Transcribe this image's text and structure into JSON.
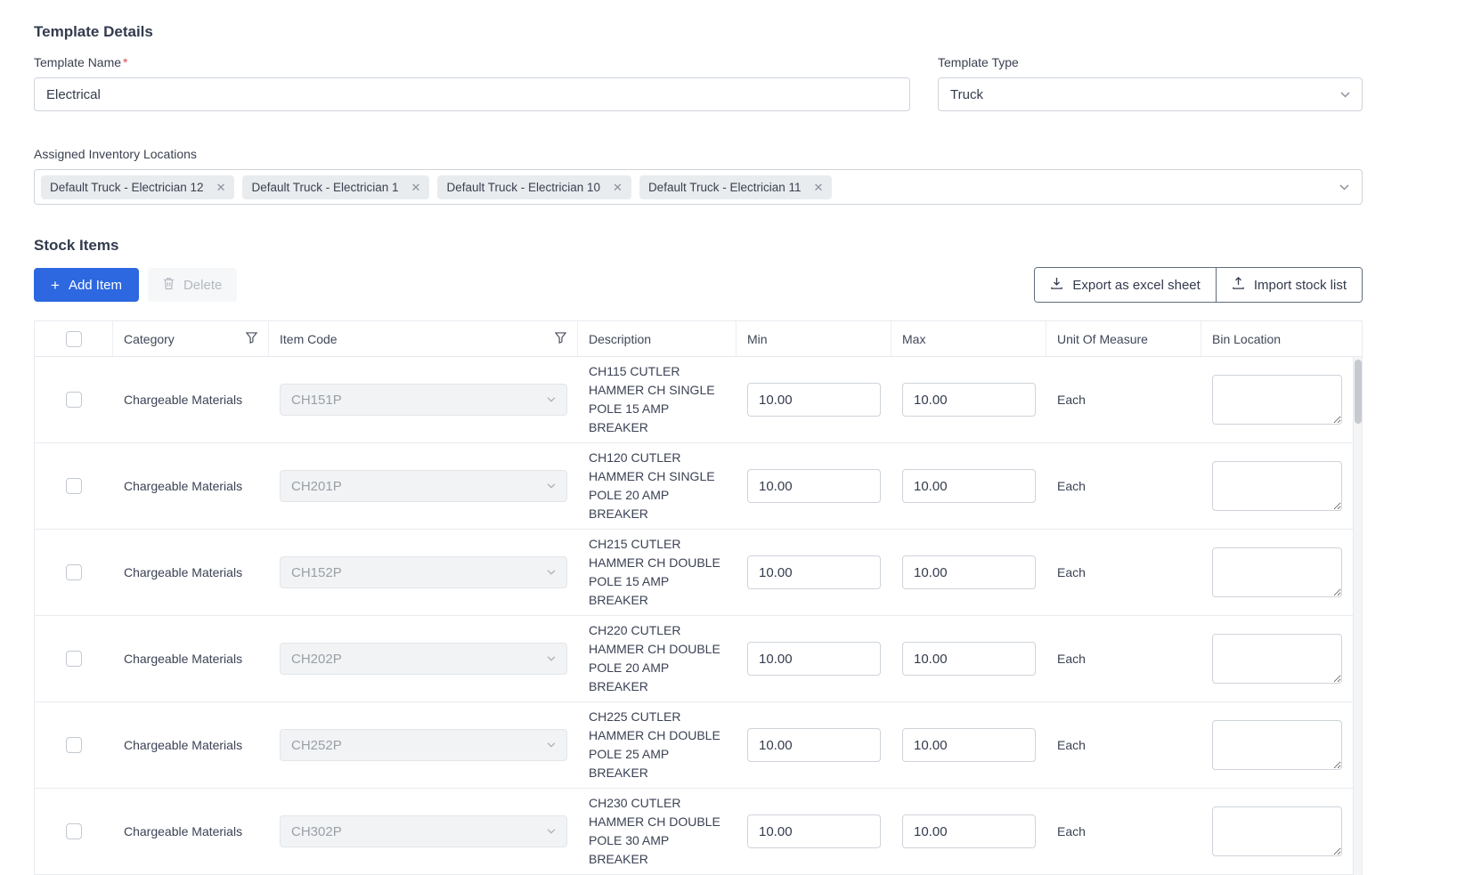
{
  "colors": {
    "accent": "#2d68e0"
  },
  "header": {
    "title": "Template Details"
  },
  "form": {
    "template_name": {
      "label": "Template Name",
      "required": "*",
      "value": "Electrical"
    },
    "template_type": {
      "label": "Template Type",
      "value": "Truck"
    },
    "locations": {
      "label": "Assigned Inventory Locations",
      "tags": [
        "Default Truck - Electrician 12",
        "Default Truck - Electrician 1",
        "Default Truck - Electrician 10",
        "Default Truck - Electrician 11"
      ]
    }
  },
  "stock": {
    "title": "Stock Items",
    "toolbar": {
      "add": "Add Item",
      "delete": "Delete",
      "export": "Export as excel sheet",
      "import": "Import stock list"
    },
    "table": {
      "headers": [
        "Category",
        "Item Code",
        "Description",
        "Min",
        "Max",
        "Unit Of Measure",
        "Bin Location"
      ],
      "rows": [
        {
          "category": "Chargeable Materials",
          "item_code": "CH151P",
          "description": "CH115 CUTLER HAMMER CH SINGLE POLE 15 AMP BREAKER",
          "min": "10.00",
          "max": "10.00",
          "uom": "Each",
          "bin": ""
        },
        {
          "category": "Chargeable Materials",
          "item_code": "CH201P",
          "description": "CH120 CUTLER HAMMER CH SINGLE POLE 20 AMP BREAKER",
          "min": "10.00",
          "max": "10.00",
          "uom": "Each",
          "bin": ""
        },
        {
          "category": "Chargeable Materials",
          "item_code": "CH152P",
          "description": "CH215 CUTLER HAMMER CH DOUBLE POLE 15 AMP BREAKER",
          "min": "10.00",
          "max": "10.00",
          "uom": "Each",
          "bin": ""
        },
        {
          "category": "Chargeable Materials",
          "item_code": "CH202P",
          "description": "CH220 CUTLER HAMMER CH DOUBLE POLE 20 AMP BREAKER",
          "min": "10.00",
          "max": "10.00",
          "uom": "Each",
          "bin": ""
        },
        {
          "category": "Chargeable Materials",
          "item_code": "CH252P",
          "description": "CH225 CUTLER HAMMER CH DOUBLE POLE 25 AMP BREAKER",
          "min": "10.00",
          "max": "10.00",
          "uom": "Each",
          "bin": ""
        },
        {
          "category": "Chargeable Materials",
          "item_code": "CH302P",
          "description": "CH230 CUTLER HAMMER CH DOUBLE POLE 30 AMP BREAKER",
          "min": "10.00",
          "max": "10.00",
          "uom": "Each",
          "bin": ""
        }
      ]
    }
  }
}
